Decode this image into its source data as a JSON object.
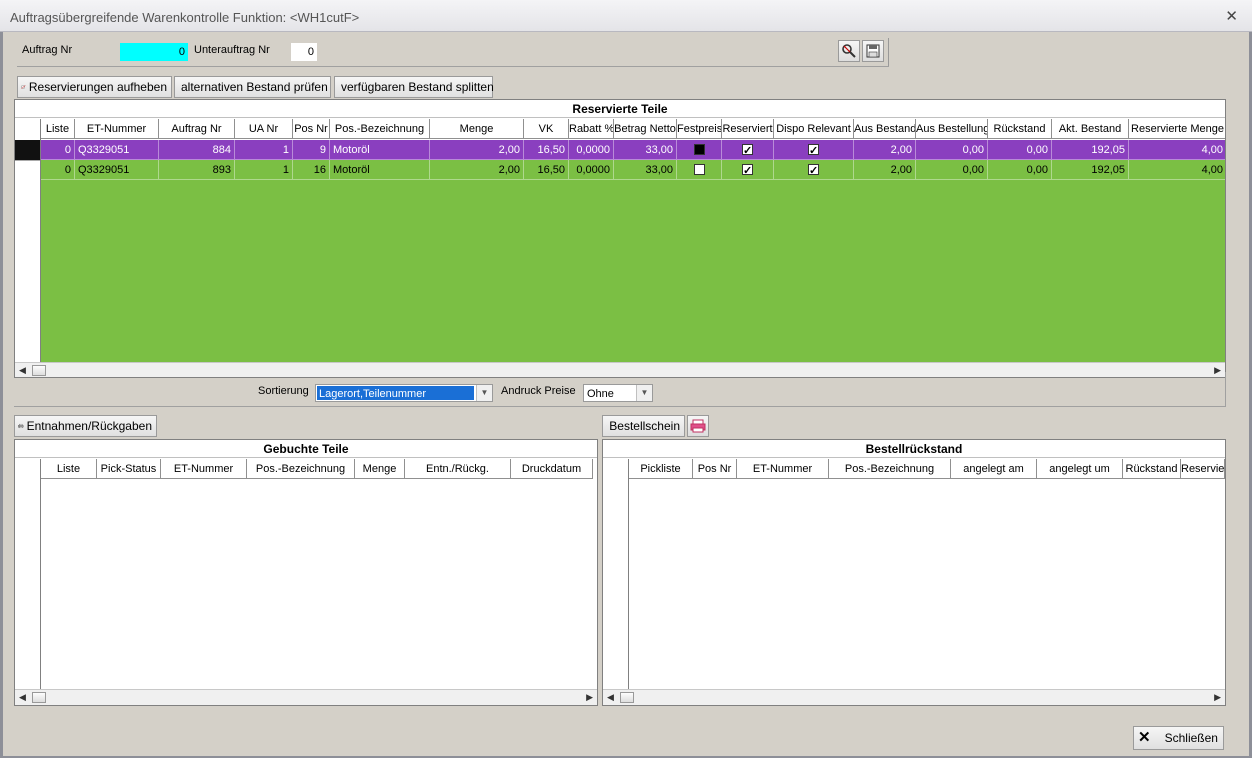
{
  "window": {
    "title": "Auftragsübergreifende Warenkontrolle  Funktion: <WH1cutF>"
  },
  "header": {
    "auftrag_label": "Auftrag Nr",
    "auftrag_value": "0",
    "unterauftrag_label": "Unterauftrag Nr",
    "unterauftrag_value": "0"
  },
  "toolbar": {
    "reservierungen_aufheben": "Reservierungen aufheben",
    "alternativen_bestand": "alternativen Bestand prüfen",
    "verfuegbaren_bestand": "verfügbaren Bestand splitten"
  },
  "reserved": {
    "title": "Reservierte Teile",
    "columns": [
      "Liste",
      "ET-Nummer",
      "Auftrag Nr",
      "UA Nr",
      "Pos Nr",
      "Pos.-Bezeichnung",
      "Menge",
      "VK",
      "Rabatt %",
      "Betrag Netto",
      "Festpreis",
      "Reserviert",
      "Dispo Relevant",
      "Aus Bestand",
      "Aus Bestellung",
      "Rückstand",
      "Akt. Bestand",
      "Reservierte Menge"
    ],
    "rows": [
      {
        "liste": "0",
        "et": "Q3329051",
        "auftrag": "884",
        "ua": "1",
        "pos": "9",
        "bez": "Motoröl",
        "menge": "2,00",
        "vk": "16,50",
        "rabatt": "0,0000",
        "betrag": "33,00",
        "festpreis": true,
        "reserviert": true,
        "dispo": true,
        "aus_bestand": "2,00",
        "aus_bestellung": "0,00",
        "rueckstand": "0,00",
        "akt_bestand": "192,05",
        "res_menge": "4,00"
      },
      {
        "liste": "0",
        "et": "Q3329051",
        "auftrag": "893",
        "ua": "1",
        "pos": "16",
        "bez": "Motoröl",
        "menge": "2,00",
        "vk": "16,50",
        "rabatt": "0,0000",
        "betrag": "33,00",
        "festpreis": false,
        "reserviert": true,
        "dispo": true,
        "aus_bestand": "2,00",
        "aus_bestellung": "0,00",
        "rueckstand": "0,00",
        "akt_bestand": "192,05",
        "res_menge": "4,00"
      }
    ],
    "colors": {
      "selected": "#8a3fbf",
      "green": "#7bbf44"
    }
  },
  "options": {
    "sortierung_label": "Sortierung",
    "sortierung_value": "Lagerort,Teilenummer",
    "andruck_label": "Andruck Preise",
    "andruck_value": "Ohne"
  },
  "booked": {
    "button": "Entnahmen/Rückgaben",
    "title": "Gebuchte Teile",
    "columns": [
      "Liste",
      "Pick-Status",
      "ET-Nummer",
      "Pos.-Bezeichnung",
      "Menge",
      "Entn./Rückg.",
      "Druckdatum"
    ]
  },
  "backorder": {
    "button": "Bestellschein",
    "title": "Bestellrückstand",
    "columns": [
      "Pickliste",
      "Pos Nr",
      "ET-Nummer",
      "Pos.-Bezeichnung",
      "angelegt am",
      "angelegt um",
      "Rückstand",
      "Reservie"
    ]
  },
  "footer": {
    "close_label": "Schließen"
  }
}
